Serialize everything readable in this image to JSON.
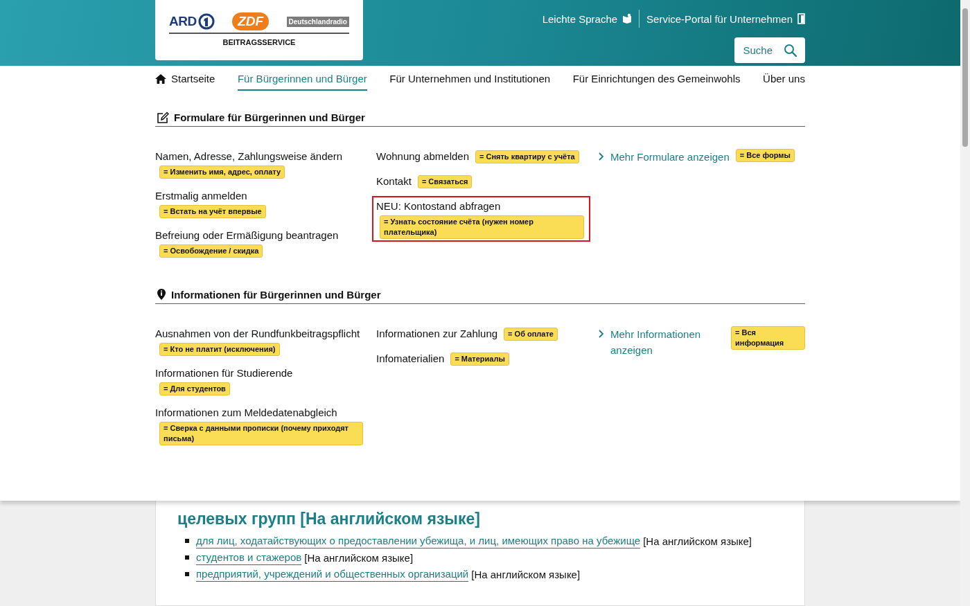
{
  "header": {
    "logo": {
      "brands": [
        {
          "kind": "ard",
          "label": "ARD"
        },
        {
          "kind": "zdf",
          "label": "ZDF"
        },
        {
          "kind": "dlr",
          "label": "Deutschlandradio"
        }
      ],
      "subtitle": "BEITRAGSSERVICE"
    },
    "links": [
      {
        "kind": "easy",
        "label": "Leichte Sprache"
      },
      {
        "kind": "portal",
        "label": "Service-Portal für Unternehmen"
      }
    ],
    "search_button": "Suche"
  },
  "nav": [
    {
      "label": "Startseite",
      "home": true,
      "selected": false
    },
    {
      "label": "Für Bürgerinnen und Bürger",
      "home": false,
      "selected": true
    },
    {
      "label": "Für Unternehmen und Institutionen",
      "home": false,
      "selected": false
    },
    {
      "label": "Für Einrichtungen des Gemeinwohls",
      "home": false,
      "selected": false
    },
    {
      "label": "Über uns",
      "home": false,
      "selected": false
    }
  ],
  "sections": [
    {
      "kind": "forms",
      "title": "Formulare für Bürgerinnen und Bürger",
      "columns": [
        [
          {
            "label": "Namen, Adresse, Zahlungsweise ändern",
            "tag": "= Изменить имя, адрес, оплату",
            "highlighted": false
          },
          {
            "label": "Erstmalig anmelden",
            "tag": "= Встать на учёт впервые",
            "highlighted": false
          },
          {
            "label": "Befreiung oder Ermäßigung beantragen",
            "tag": "= Освобождение / скидка",
            "highlighted": false
          }
        ],
        [
          {
            "label": "Wohnung abmelden",
            "tag": "= Снять квартиру с учёта",
            "highlighted": false
          },
          {
            "label": "Kontakt",
            "tag": "= Связаться",
            "highlighted": false
          },
          {
            "label": "NEU: Kontostand abfragen",
            "tag": "= Узнать состояние счёта (нужен номер плательщика)",
            "highlighted": true
          }
        ]
      ],
      "more": {
        "label": "Mehr Formulare anzeigen",
        "tag": "= Все формы"
      }
    },
    {
      "kind": "info",
      "title": "Informationen für Bürgerinnen und Bürger",
      "columns": [
        [
          {
            "label": "Ausnahmen von der Rundfunkbeitragspflicht",
            "tag": "= Кто не платит (исключения)",
            "highlighted": false
          },
          {
            "label": "Informationen für Studierende",
            "tag": "= Для студентов",
            "highlighted": false
          },
          {
            "label": "Informationen zum Meldedatenabgleich",
            "tag": "= Сверка с данными прописки (почему приходят письма)",
            "highlighted": false
          }
        ],
        [
          {
            "label": "Informationen zur Zahlung",
            "tag": "= Об оплате",
            "highlighted": false
          },
          {
            "label": "Infomaterialien",
            "tag": "= Материалы",
            "highlighted": false
          }
        ]
      ],
      "more": {
        "label": "Mehr Informationen anzeigen",
        "tag": "= Вся информация"
      }
    }
  ],
  "lower": {
    "heading_lines": [
      "целевых групп [На английском языке]"
    ],
    "list": [
      {
        "link": "для лиц, ходатайствующих о предоставлении убежища, и лиц, имеющих право на убежище",
        "note": "[На английском языке]"
      },
      {
        "link": "студентов и стажеров",
        "note": "[На английском языке]"
      },
      {
        "link": "предприятий, учреждений и общественных организаций",
        "note": "[На английском языке]"
      }
    ]
  }
}
